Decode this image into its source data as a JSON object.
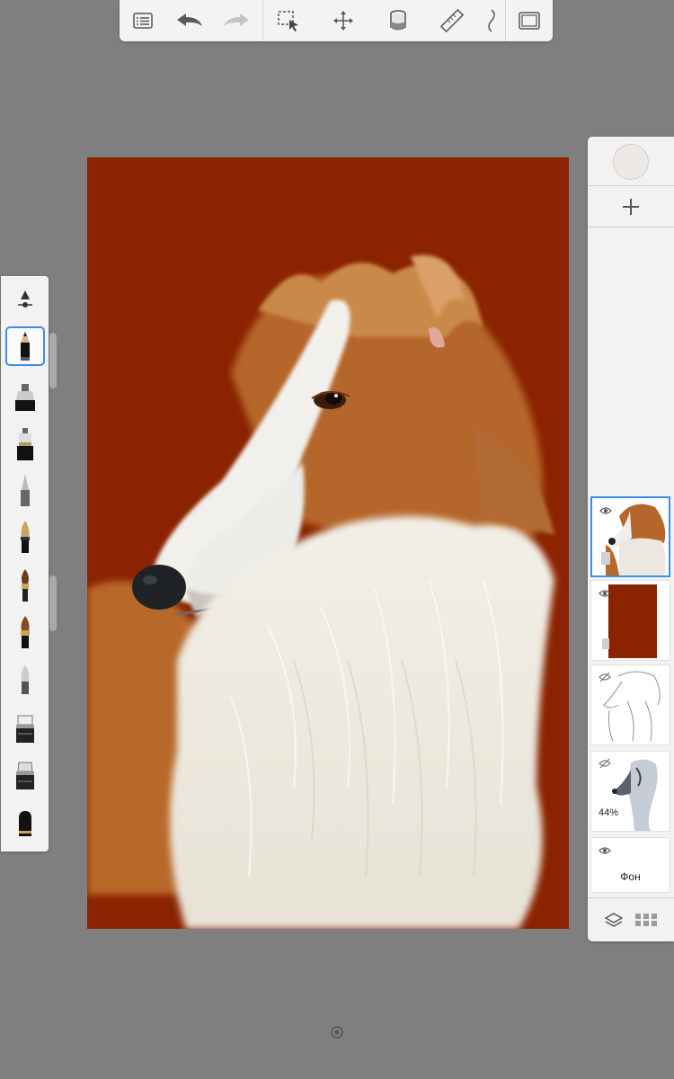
{
  "app": {
    "toolbar": {
      "buttons": [
        "menu",
        "undo",
        "redo",
        "selection",
        "transform",
        "fill",
        "ruler",
        "symmetry",
        "fullscreen"
      ]
    },
    "brush_palette": {
      "brushes": [
        "brush-settings",
        "pencil",
        "marker",
        "fineliner",
        "airbrush",
        "pen",
        "paintbrush",
        "paintbrush-thick",
        "smudge",
        "eraser",
        "eraser-hard",
        "fill-brush"
      ],
      "selected": "pencil"
    },
    "layers": {
      "items": [
        {
          "name": "",
          "visible": true,
          "selected": true,
          "opacity": ""
        },
        {
          "name": "",
          "visible": true,
          "selected": false,
          "opacity": ""
        },
        {
          "name": "",
          "visible": false,
          "selected": false,
          "opacity": ""
        },
        {
          "name": "",
          "visible": false,
          "selected": false,
          "opacity": "44%"
        },
        {
          "name": "Фон",
          "visible": true,
          "selected": false,
          "opacity": ""
        }
      ]
    },
    "colors": {
      "canvas_background": "#8b2300",
      "current_color": "#efe9e6",
      "accent": "#3b8ee8"
    }
  }
}
